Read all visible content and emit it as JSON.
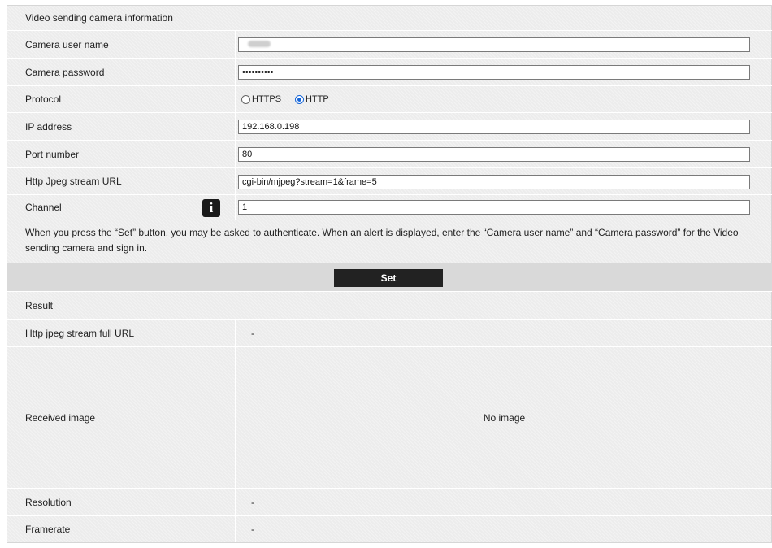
{
  "section_title": "Video sending camera information",
  "fields": {
    "user_name": {
      "label": "Camera user name"
    },
    "password": {
      "label": "Camera password",
      "value": "••••••••••"
    },
    "protocol": {
      "label": "Protocol",
      "options": [
        "HTTPS",
        "HTTP"
      ],
      "selected": "HTTP"
    },
    "ip": {
      "label": "IP address",
      "value": "192.168.0.198"
    },
    "port": {
      "label": "Port number",
      "value": "80"
    },
    "stream_url": {
      "label": "Http Jpeg stream URL",
      "value": "cgi-bin/mjpeg?stream=1&frame=5"
    },
    "channel": {
      "label": "Channel",
      "value": "1",
      "info_icon": "i"
    }
  },
  "note": "When you press the “Set” button, you may be asked to authenticate. When an alert is displayed, enter the “Camera user name” and “Camera password” for the Video sending camera and sign in.",
  "set_button": "Set",
  "result": {
    "title": "Result",
    "full_url": {
      "label": "Http jpeg stream full URL",
      "value": "-"
    },
    "received_image": {
      "label": "Received image",
      "value": "No image"
    },
    "resolution": {
      "label": "Resolution",
      "value": "-"
    },
    "framerate": {
      "label": "Framerate",
      "value": "-"
    }
  }
}
